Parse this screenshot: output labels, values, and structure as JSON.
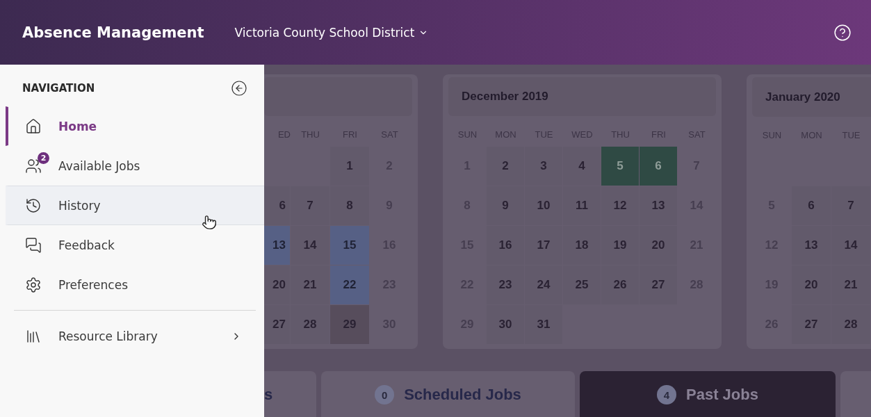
{
  "header": {
    "title": "Absence Management",
    "district": "Victoria County School District"
  },
  "navigation": {
    "heading": "NAVIGATION",
    "items": [
      {
        "label": "Home",
        "selected": true,
        "hovered": false,
        "kind": "link"
      },
      {
        "label": "Available Jobs",
        "selected": false,
        "hovered": false,
        "kind": "link",
        "badge": "2"
      },
      {
        "label": "History",
        "selected": false,
        "hovered": true,
        "kind": "link"
      },
      {
        "label": "Feedback",
        "selected": false,
        "hovered": false,
        "kind": "link"
      },
      {
        "label": "Preferences",
        "selected": false,
        "hovered": false,
        "kind": "link"
      },
      {
        "label": "Resource Library",
        "selected": false,
        "hovered": false,
        "kind": "submenu"
      }
    ]
  },
  "calendars": [
    {
      "cut_left": true,
      "cut_right": false,
      "weekdays": [
        "ED",
        "THU",
        "FRI",
        "SAT"
      ],
      "weeks": [
        [
          {
            "kind": "empty"
          },
          {
            "kind": "empty"
          },
          {
            "day": "1",
            "kind": "weekday"
          },
          {
            "day": "2",
            "kind": "weekend"
          }
        ],
        [
          {
            "day": "6",
            "kind": "weekday"
          },
          {
            "day": "7",
            "kind": "weekday"
          },
          {
            "day": "8",
            "kind": "weekday"
          },
          {
            "day": "9",
            "kind": "weekend"
          }
        ],
        [
          {
            "day": "13",
            "kind": "blue"
          },
          {
            "day": "14",
            "kind": "weekday"
          },
          {
            "day": "15",
            "kind": "blue"
          },
          {
            "day": "16",
            "kind": "weekend"
          }
        ],
        [
          {
            "day": "20",
            "kind": "weekday"
          },
          {
            "day": "21",
            "kind": "weekday"
          },
          {
            "day": "22",
            "kind": "blue"
          },
          {
            "day": "23",
            "kind": "weekend"
          }
        ],
        [
          {
            "day": "27",
            "kind": "weekday"
          },
          {
            "day": "28",
            "kind": "weekday"
          },
          {
            "day": "29",
            "kind": "gray"
          },
          {
            "day": "30",
            "kind": "weekend"
          }
        ]
      ]
    },
    {
      "cut_left": false,
      "cut_right": false,
      "title": "December 2019",
      "weekdays": [
        "SUN",
        "MON",
        "TUE",
        "WED",
        "THU",
        "FRI",
        "SAT"
      ],
      "weeks": [
        [
          {
            "day": "1",
            "kind": "weekend"
          },
          {
            "day": "2",
            "kind": "weekday"
          },
          {
            "day": "3",
            "kind": "weekday"
          },
          {
            "day": "4",
            "kind": "weekday"
          },
          {
            "day": "5",
            "kind": "green"
          },
          {
            "day": "6",
            "kind": "green"
          },
          {
            "day": "7",
            "kind": "weekend"
          }
        ],
        [
          {
            "day": "8",
            "kind": "weekend"
          },
          {
            "day": "9",
            "kind": "weekday"
          },
          {
            "day": "10",
            "kind": "weekday"
          },
          {
            "day": "11",
            "kind": "weekday"
          },
          {
            "day": "12",
            "kind": "weekday"
          },
          {
            "day": "13",
            "kind": "weekday"
          },
          {
            "day": "14",
            "kind": "weekend"
          }
        ],
        [
          {
            "day": "15",
            "kind": "weekend"
          },
          {
            "day": "16",
            "kind": "weekday"
          },
          {
            "day": "17",
            "kind": "weekday"
          },
          {
            "day": "18",
            "kind": "weekday"
          },
          {
            "day": "19",
            "kind": "weekday"
          },
          {
            "day": "20",
            "kind": "weekday"
          },
          {
            "day": "21",
            "kind": "weekend"
          }
        ],
        [
          {
            "day": "22",
            "kind": "weekend"
          },
          {
            "day": "23",
            "kind": "weekday"
          },
          {
            "day": "24",
            "kind": "weekday"
          },
          {
            "day": "25",
            "kind": "weekday"
          },
          {
            "day": "26",
            "kind": "weekday"
          },
          {
            "day": "27",
            "kind": "weekday"
          },
          {
            "day": "28",
            "kind": "weekend"
          }
        ],
        [
          {
            "day": "29",
            "kind": "weekend"
          },
          {
            "day": "30",
            "kind": "weekday"
          },
          {
            "day": "31",
            "kind": "weekday"
          },
          {
            "kind": "empty"
          },
          {
            "kind": "empty"
          },
          {
            "kind": "empty"
          },
          {
            "kind": "empty"
          }
        ]
      ]
    },
    {
      "cut_left": false,
      "cut_right": true,
      "title": "January 2020",
      "weekdays": [
        "SUN",
        "MON",
        "TUE"
      ],
      "weeks": [
        [
          {
            "kind": "empty"
          },
          {
            "kind": "empty"
          },
          {
            "kind": "empty"
          }
        ],
        [
          {
            "day": "5",
            "kind": "weekend"
          },
          {
            "day": "6",
            "kind": "weekday"
          },
          {
            "day": "7",
            "kind": "weekday"
          }
        ],
        [
          {
            "day": "12",
            "kind": "weekend"
          },
          {
            "day": "13",
            "kind": "weekday"
          },
          {
            "day": "14",
            "kind": "weekday"
          }
        ],
        [
          {
            "day": "19",
            "kind": "weekend"
          },
          {
            "day": "20",
            "kind": "weekday"
          },
          {
            "day": "21",
            "kind": "weekday"
          }
        ],
        [
          {
            "day": "26",
            "kind": "weekend"
          },
          {
            "day": "27",
            "kind": "weekday"
          },
          {
            "day": "28",
            "kind": "weekday"
          }
        ]
      ]
    }
  ],
  "tabs": [
    {
      "label": "s",
      "selected": false
    },
    {
      "label": "Scheduled Jobs",
      "count": "0",
      "selected": false
    },
    {
      "label": "Past Jobs",
      "count": "4",
      "selected": true
    }
  ]
}
